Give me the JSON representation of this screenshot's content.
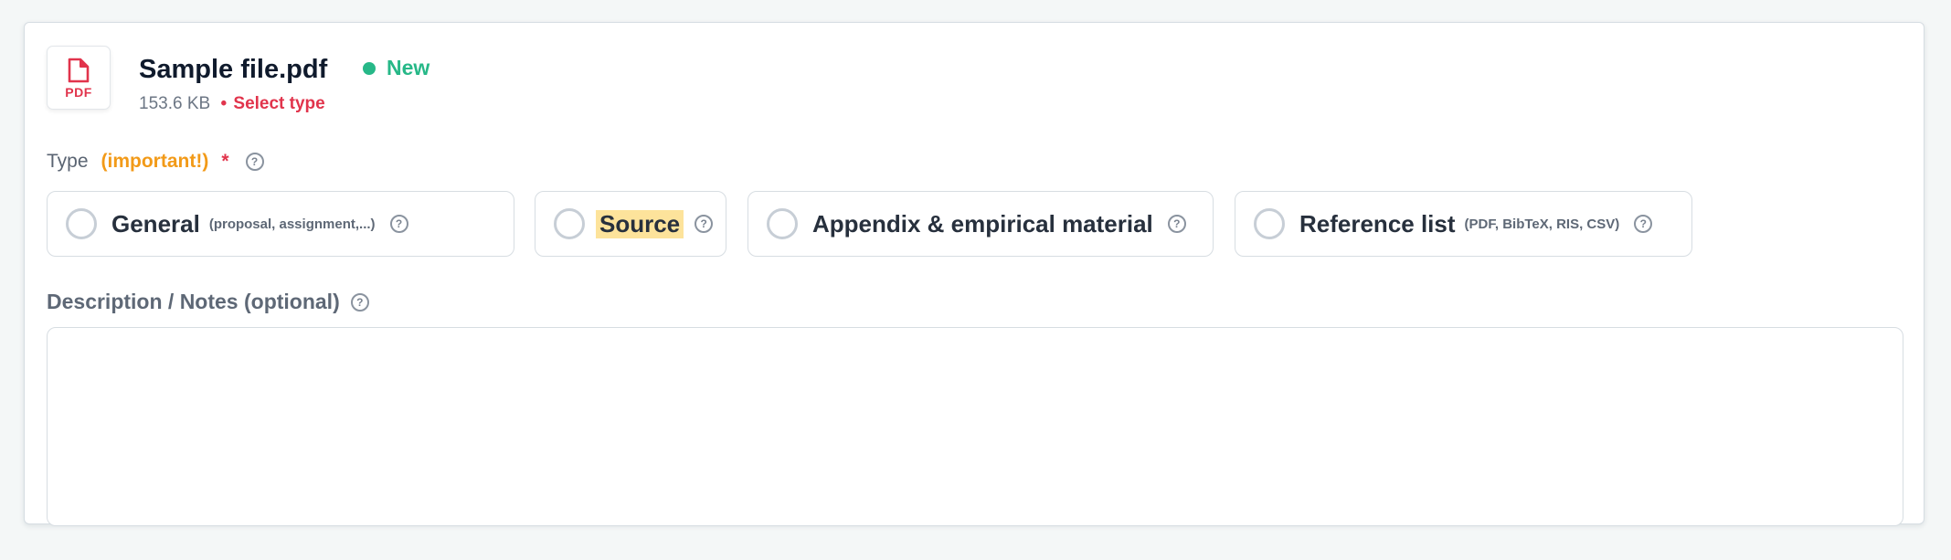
{
  "file": {
    "icon": "pdf-file-icon",
    "icon_label": "PDF",
    "name": "Sample file.pdf",
    "status": "New",
    "size": "153.6 KB",
    "separator": "•",
    "action": "Select type"
  },
  "type_field": {
    "label": "Type",
    "important": "(important!)",
    "required_mark": "*",
    "options": [
      {
        "label": "General",
        "hint": "(proposal, assignment,...)",
        "selected": false
      },
      {
        "label": "Source",
        "hint": "",
        "selected": false
      },
      {
        "label": "Appendix & empirical material",
        "hint": "",
        "selected": false
      },
      {
        "label": "Reference list",
        "hint": "(PDF, BibTeX, RIS, CSV)",
        "selected": false
      }
    ]
  },
  "description": {
    "label": "Description / Notes (optional)",
    "value": "",
    "placeholder": ""
  },
  "help_glyph": "?",
  "colors": {
    "status_green": "#27b888",
    "danger_red": "#e1344c",
    "important_orange": "#f29a18",
    "highlight_yellow": "#fde39b"
  }
}
